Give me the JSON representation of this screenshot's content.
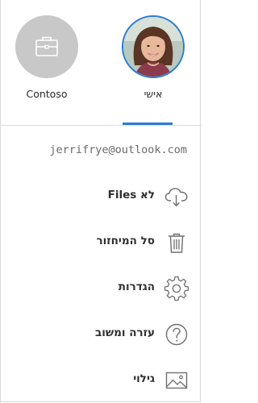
{
  "accounts": [
    {
      "label": "Contoso",
      "icon": "briefcase-icon",
      "selected": false
    },
    {
      "label": "אישי",
      "icon": "avatar",
      "selected": true
    }
  ],
  "email": "jerrifrye@outlook.com",
  "menu": [
    {
      "label": "לא Files",
      "icon": "cloud-download-icon"
    },
    {
      "label": "סל המיחזור",
      "icon": "trash-icon"
    },
    {
      "label": "הגדרות",
      "icon": "gear-icon"
    },
    {
      "label": "עזרה ומשוב",
      "icon": "help-icon"
    },
    {
      "label": "גילוי",
      "icon": "image-icon"
    }
  ],
  "colors": {
    "accent": "#2b7cd3",
    "icon": "#6e6e6e",
    "contoso_bg": "#c8c8c8"
  }
}
